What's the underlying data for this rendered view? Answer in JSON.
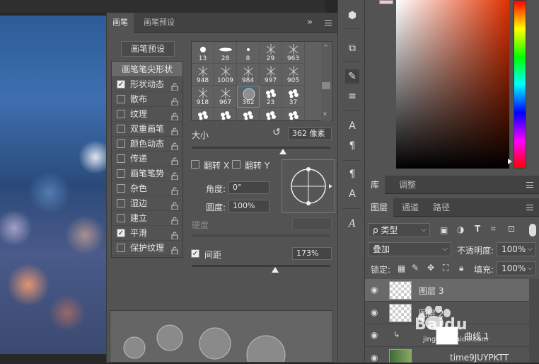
{
  "brush_panel": {
    "tabs": [
      "画笔",
      "画笔预设"
    ],
    "preset_button": "画笔预设",
    "options_header": "画笔笔尖形状",
    "options": [
      {
        "label": "形状动态",
        "checked": true
      },
      {
        "label": "散布",
        "checked": false
      },
      {
        "label": "纹理",
        "checked": false
      },
      {
        "label": "双重画笔",
        "checked": false
      },
      {
        "label": "颜色动态",
        "checked": false
      },
      {
        "label": "传递",
        "checked": false
      },
      {
        "label": "画笔笔势",
        "checked": false
      },
      {
        "label": "杂色",
        "checked": false
      },
      {
        "label": "湿边",
        "checked": false
      },
      {
        "label": "建立",
        "checked": false
      },
      {
        "label": "平滑",
        "checked": true
      },
      {
        "label": "保护纹理",
        "checked": false
      }
    ],
    "brush_sizes": [
      "13",
      "28",
      "8",
      "29",
      "963",
      "948",
      "1009",
      "984",
      "997",
      "905",
      "918",
      "967",
      "362",
      "23",
      "37",
      "",
      "",
      "",
      "",
      ""
    ],
    "size_label": "大小",
    "size_value": "362 像素",
    "size_fraction": 0.66,
    "flip_x": "翻转 X",
    "flip_y": "翻转 Y",
    "angle_label": "角度:",
    "angle_value": "0°",
    "roundness_label": "圆度:",
    "roundness_value": "100%",
    "hardness_label": "硬度",
    "spacing_label": "间距",
    "spacing_checked": true,
    "spacing_value": "173%",
    "spacing_fraction": 0.6,
    "collapse_glyph": "»"
  },
  "right_panel": {
    "library_tabs": [
      "库",
      "调整"
    ],
    "layers_tabs": [
      "图层",
      "通道",
      "路径"
    ],
    "filter_kind": "ρ 类型",
    "blend_mode": "叠加",
    "opacity_label": "不透明度:",
    "opacity_value": "100%",
    "lock_label": "锁定:",
    "fill_label": "填充:",
    "fill_value": "100%",
    "layers": [
      {
        "name": "图层 3",
        "active": true
      },
      {
        "name": "图层 2",
        "active": false
      },
      {
        "name": "曲线 1",
        "active": false
      },
      {
        "name": "time9JUYPKTT",
        "active": false
      }
    ]
  },
  "watermark": {
    "text": "Baidu",
    "sub": "jingyan.baidu.com"
  }
}
